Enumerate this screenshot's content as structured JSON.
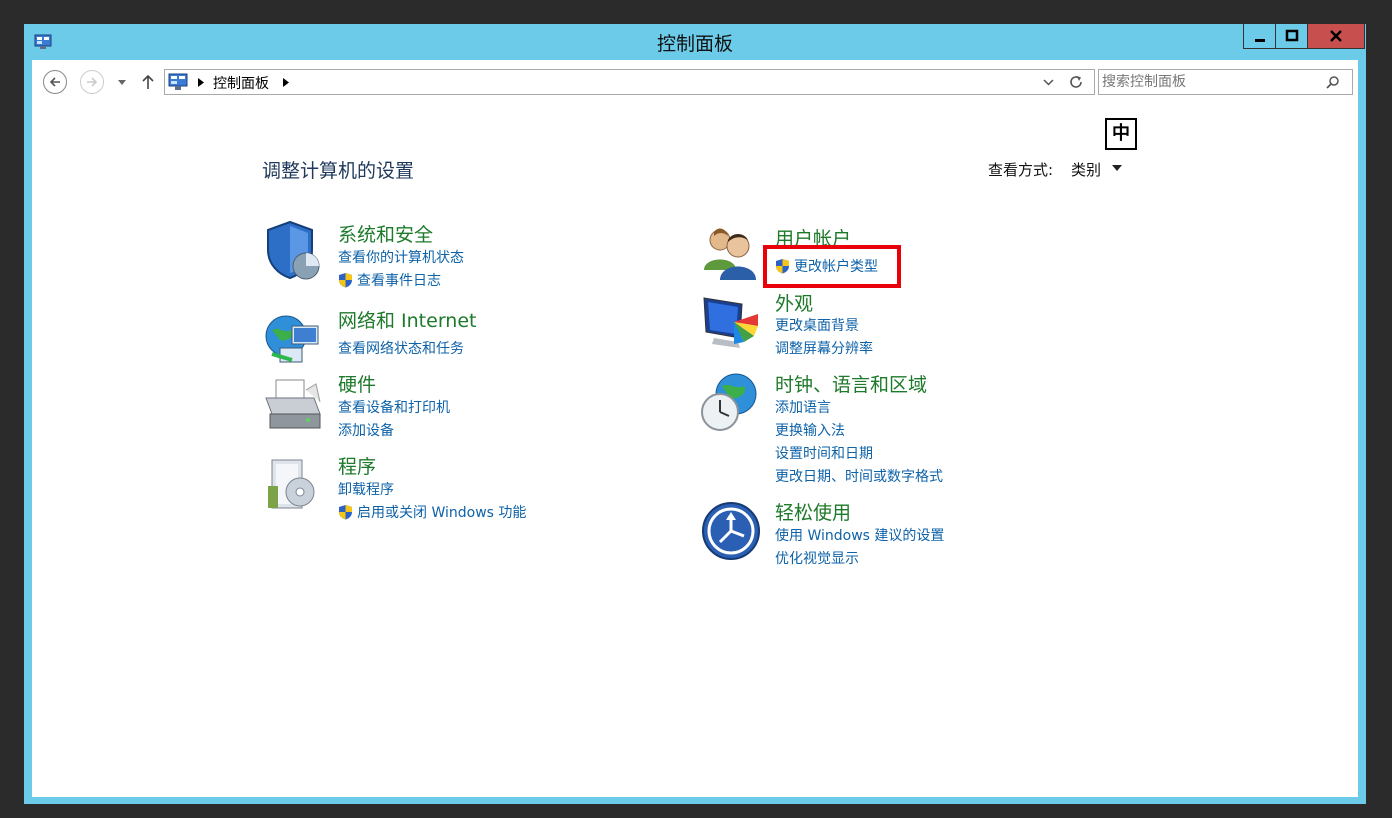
{
  "window": {
    "title": "控制面板"
  },
  "nav": {
    "breadcrumb": "控制面板",
    "search_placeholder": "搜索控制面板",
    "ime_indicator": "中"
  },
  "page": {
    "heading": "调整计算机的设置",
    "view_by_label": "查看方式:",
    "view_by_value": "类别"
  },
  "categories": {
    "system_security": {
      "title": "系统和安全",
      "links": [
        "查看你的计算机状态",
        "查看事件日志"
      ]
    },
    "network": {
      "title": "网络和 Internet",
      "links": [
        "查看网络状态和任务"
      ]
    },
    "hardware": {
      "title": "硬件",
      "links": [
        "查看设备和打印机",
        "添加设备"
      ]
    },
    "programs": {
      "title": "程序",
      "links": [
        "卸载程序",
        "启用或关闭 Windows 功能"
      ]
    },
    "user_accounts": {
      "title": "用户帐户",
      "links": [
        "更改帐户类型"
      ]
    },
    "appearance": {
      "title": "外观",
      "links": [
        "更改桌面背景",
        "调整屏幕分辨率"
      ]
    },
    "clock_region": {
      "title": "时钟、语言和区域",
      "links": [
        "添加语言",
        "更换输入法",
        "设置时间和日期",
        "更改日期、时间或数字格式"
      ]
    },
    "ease_of_access": {
      "title": "轻松使用",
      "links": [
        "使用 Windows 建议的设置",
        "优化视觉显示"
      ]
    }
  },
  "colors": {
    "window_frame": "#6ccbe9",
    "category_title": "#1d7a2a",
    "link": "#0e62a8",
    "highlight": "#e8000a",
    "close_button": "#c7504f"
  }
}
